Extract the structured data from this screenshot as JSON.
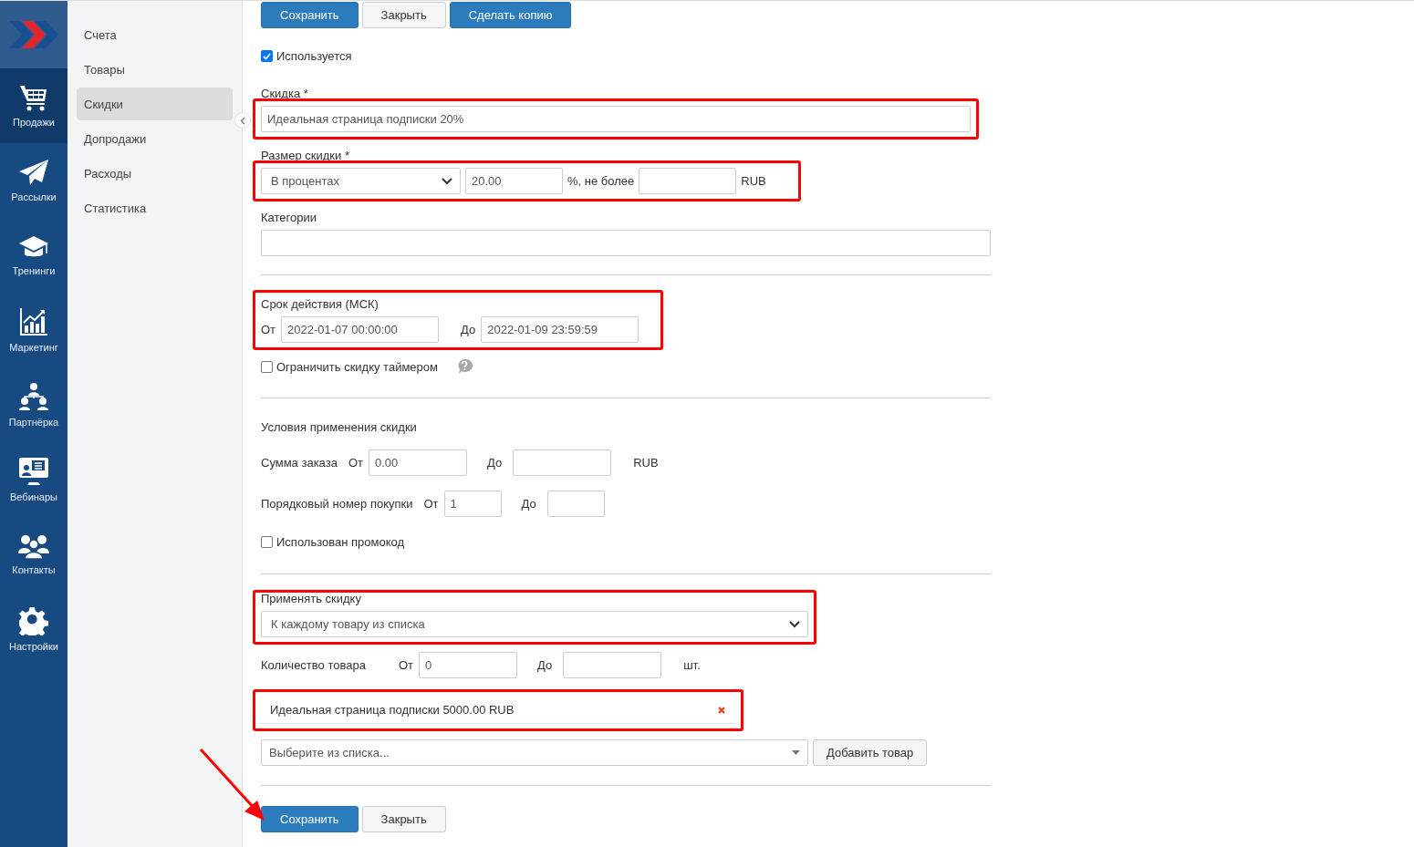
{
  "nav_rail": {
    "items": [
      {
        "label": "Продажи",
        "selected": true
      },
      {
        "label": "Рассылки",
        "selected": false
      },
      {
        "label": "Тренинги",
        "selected": false
      },
      {
        "label": "Маркетинг",
        "selected": false
      },
      {
        "label": "Партнёрка",
        "selected": false
      },
      {
        "label": "Вебинары",
        "selected": false
      },
      {
        "label": "Контакты",
        "selected": false
      },
      {
        "label": "Настройки",
        "selected": false
      }
    ]
  },
  "submenu": {
    "items": [
      {
        "label": "Счета",
        "selected": false
      },
      {
        "label": "Товары",
        "selected": false
      },
      {
        "label": "Скидки",
        "selected": true
      },
      {
        "label": "Допродажи",
        "selected": false
      },
      {
        "label": "Расходы",
        "selected": false
      },
      {
        "label": "Статистика",
        "selected": false
      }
    ]
  },
  "top_buttons": [
    {
      "label": "Сохранить",
      "kind": "primary"
    },
    {
      "label": "Закрыть",
      "kind": "default"
    },
    {
      "label": "Сделать копию",
      "kind": "primary"
    }
  ],
  "used_checkbox": {
    "label": "Используется",
    "checked": true
  },
  "discount_name": {
    "label": "Скидка *",
    "value": "Идеальная страница подписки 20%",
    "highlighted": true
  },
  "discount_size": {
    "label": "Размер скидки *",
    "type_select": "В процентах",
    "amount": "20.00",
    "max_label": "%, не более",
    "currency": "RUB",
    "highlighted": true
  },
  "categories": {
    "label": "Категории"
  },
  "validity": {
    "label": "Срок действия (МСК)",
    "from_label": "От",
    "from": "2022-01-07 00:00:00",
    "to_label": "До",
    "to": "2022-01-09 23:59:59",
    "highlighted": true
  },
  "timer_checkbox": {
    "label": "Ограничить скидку таймером",
    "checked": false
  },
  "conditions": {
    "title": "Условия применения скидки",
    "order_sum": {
      "label": "Сумма заказа",
      "from_label": "От",
      "from": "0.00",
      "to_label": "До",
      "currency": "RUB"
    },
    "purchase_number": {
      "label": "Порядковый номер покупки",
      "from_label": "От",
      "from": "1",
      "to_label": "До"
    },
    "promo_checkbox": {
      "label": "Использован промокод",
      "checked": false
    }
  },
  "apply": {
    "label": "Применять скидку",
    "value": "К каждому товару из списка",
    "highlighted": true
  },
  "quantity": {
    "label": "Количество товара",
    "from_label": "От",
    "from": "0",
    "to_label": "До",
    "unit": "шт."
  },
  "product_list": {
    "highlighted": true,
    "items": [
      {
        "label": "Идеальная страница подписки 5000.00 RUB"
      }
    ]
  },
  "product_picker": {
    "placeholder": "Выберите из списка...",
    "button": "Добавить товар"
  },
  "bottom_buttons": [
    {
      "label": "Сохранить",
      "kind": "primary"
    },
    {
      "label": "Закрыть",
      "kind": "default"
    }
  ]
}
